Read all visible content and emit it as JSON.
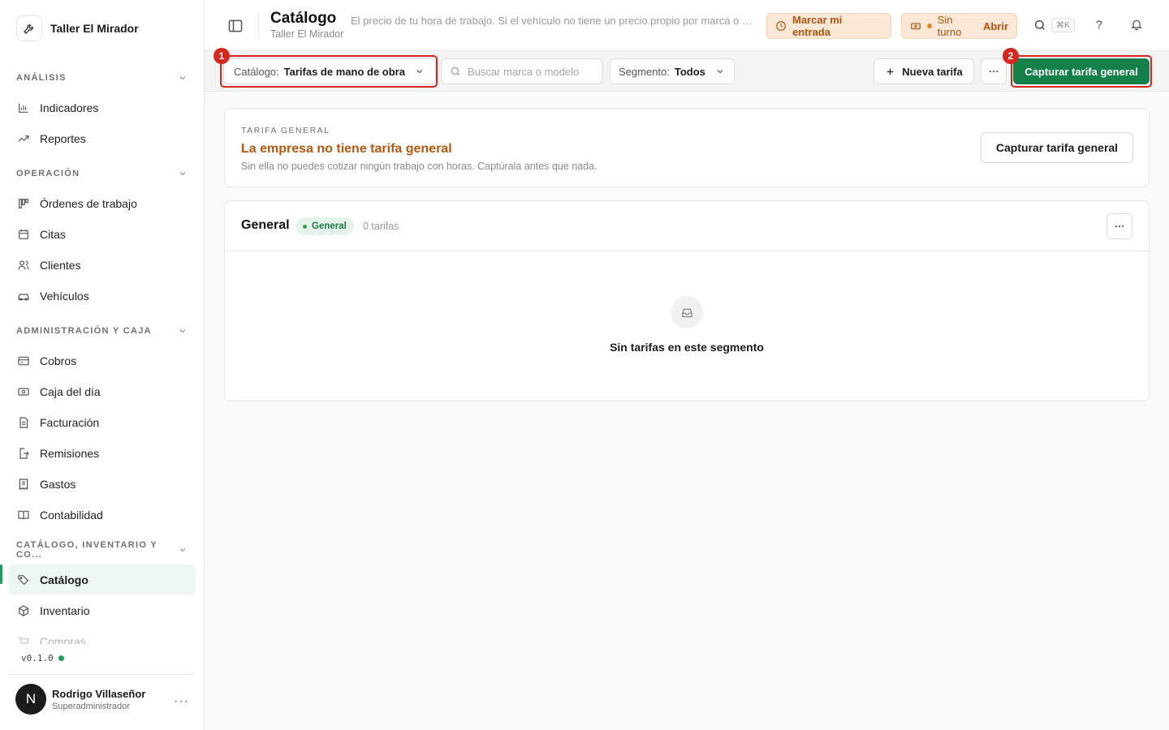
{
  "brand": {
    "name": "Taller El Mirador"
  },
  "sidebar": {
    "sections": {
      "analisis": "ANÁLISIS",
      "operacion": "OPERACIÓN",
      "admin": "ADMINISTRACIÓN Y CAJA",
      "catalogo": "CATÁLOGO, INVENTARIO Y CO..."
    },
    "items": {
      "indicadores": "Indicadores",
      "reportes": "Reportes",
      "ordenes": "Órdenes de trabajo",
      "citas": "Citas",
      "clientes": "Clientes",
      "vehiculos": "Vehículos",
      "cobros": "Cobros",
      "caja": "Caja del día",
      "facturacion": "Facturación",
      "remisiones": "Remisiones",
      "gastos": "Gastos",
      "contabilidad": "Contabilidad",
      "catalogo": "Catálogo",
      "inventario": "Inventario",
      "compras": "Compras"
    },
    "version": "v0.1.0"
  },
  "user": {
    "initial": "N",
    "name": "Rodrigo Villaseñor",
    "role": "Superadministrador"
  },
  "header": {
    "title": "Catálogo",
    "subtitle": "Taller El Mirador",
    "description": "El precio de tu hora de trabajo. Si el vehículo no tiene un precio propio por marca o modelo, se usa la tarifa general.",
    "entrada_label": "Marcar mi entrada",
    "turno_status": "Sin turno",
    "turno_action": "Abrir",
    "shortcut": "⌘K",
    "help": "?"
  },
  "toolbar": {
    "catalog_label": "Catálogo:",
    "catalog_value": "Tarifas de mano de obra",
    "search_placeholder": "Buscar marca o modelo",
    "segment_label": "Segmento:",
    "segment_value": "Todos",
    "new_rate": "Nueva tarifa",
    "capture_general": "Capturar tarifa general"
  },
  "annotations": {
    "marker1": "1",
    "marker2": "2"
  },
  "general_rate_card": {
    "eyebrow": "TARIFA GENERAL",
    "title": "La empresa no tiene tarifa general",
    "description": "Sin ella no puedes cotizar ningún trabajo con horas. Captúrala antes que nada.",
    "button": "Capturar tarifa general"
  },
  "segment_card": {
    "title": "General",
    "badge": "General",
    "count": "0 tarifas",
    "empty_message": "Sin tarifas en este segmento"
  },
  "colors": {
    "accent": "#14804a",
    "warning": "#b8570f",
    "annotation": "#d7261e"
  }
}
